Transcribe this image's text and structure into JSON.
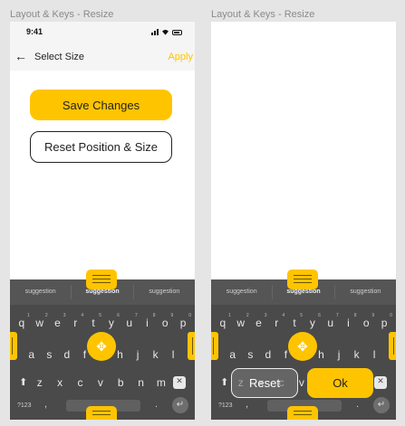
{
  "frames": [
    {
      "title": "Layout & Keys - Resize"
    },
    {
      "title": "Layout & Keys - Resize"
    }
  ],
  "status": {
    "time": "9:41",
    "icons": [
      "signal-icon",
      "wifi-icon",
      "battery-icon"
    ]
  },
  "nav": {
    "back_icon": "←",
    "title": "Select Size",
    "apply": "Apply"
  },
  "actions": {
    "save": "Save Changes",
    "reset": "Reset Position & Size"
  },
  "keyboard": {
    "suggestions": [
      "suggestion",
      "suggestion",
      "suggestion"
    ],
    "row1": [
      {
        "k": "q",
        "n": "1"
      },
      {
        "k": "w",
        "n": "2"
      },
      {
        "k": "e",
        "n": "3"
      },
      {
        "k": "r",
        "n": "4"
      },
      {
        "k": "t",
        "n": "5"
      },
      {
        "k": "y",
        "n": "6"
      },
      {
        "k": "u",
        "n": "7"
      },
      {
        "k": "i",
        "n": "8"
      },
      {
        "k": "o",
        "n": "9"
      },
      {
        "k": "p",
        "n": "0"
      }
    ],
    "row2": [
      "a",
      "s",
      "d",
      "f",
      "g",
      "h",
      "j",
      "k",
      "l"
    ],
    "row3": [
      "z",
      "x",
      "c",
      "v",
      "b",
      "n",
      "m"
    ],
    "symbols": "?123",
    "comma": ",",
    "period": ".",
    "enter": "↵",
    "shift": "⬆",
    "backspace": "✕"
  },
  "overlay": {
    "reset": "Reset",
    "ok": "Ok"
  },
  "colors": {
    "accent": "#ffc400",
    "keyboard_bg": "#4a4a4a",
    "screen_bg": "#ffffff"
  }
}
